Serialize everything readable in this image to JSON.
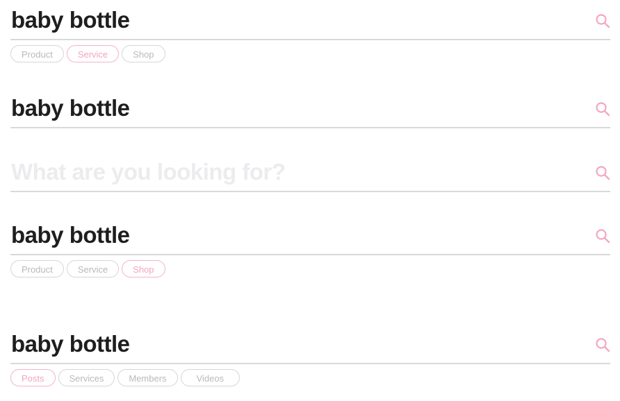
{
  "colors": {
    "accent": "#f4a7bf",
    "text": "#1e1e1e",
    "placeholder": "#ececef",
    "tab_text": "#b9b9be",
    "divider": "#d9d9d9"
  },
  "icons": {
    "search": "search-icon"
  },
  "blocks": [
    {
      "query": "baby bottle",
      "tabs": [
        "Product",
        "Service",
        "Shop"
      ],
      "active_tab": "Service"
    },
    {
      "query": "baby bottle"
    },
    {
      "placeholder": "What are you looking for?"
    },
    {
      "query": "baby bottle",
      "tabs": [
        "Product",
        "Service",
        "Shop"
      ],
      "active_tab": "Shop"
    },
    {
      "query": "baby bottle",
      "tabs": [
        "Posts",
        "Services",
        "Members",
        "Videos"
      ],
      "active_tab": "Posts"
    }
  ]
}
